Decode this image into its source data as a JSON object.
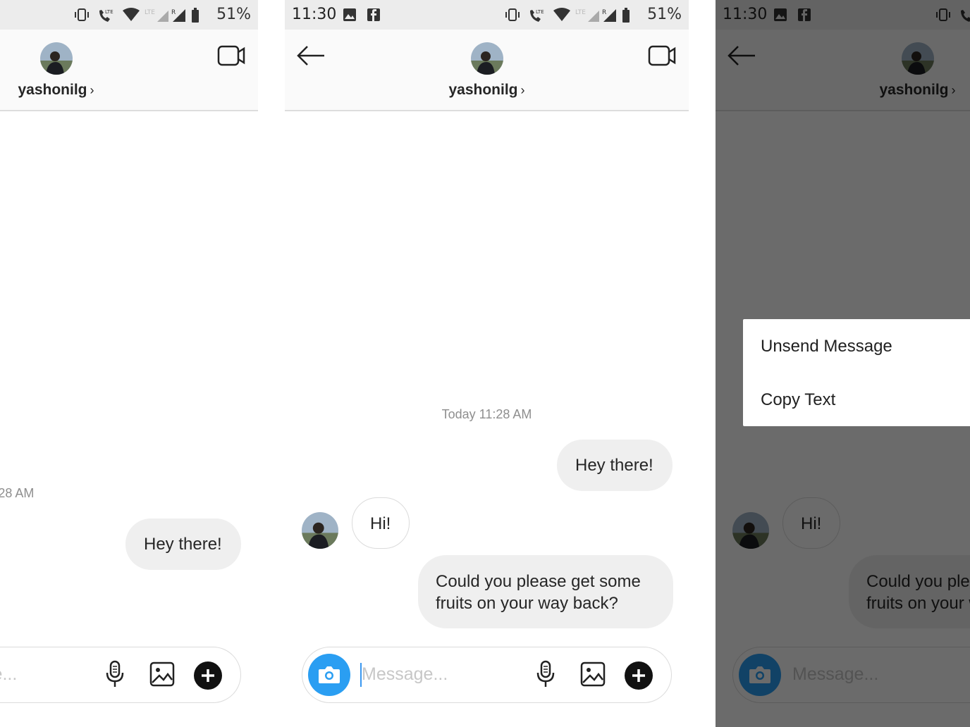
{
  "status": {
    "time": "11:30",
    "battery": "51%",
    "lte_label": "LTE",
    "roaming": "R"
  },
  "thread": {
    "username": "yashonilg",
    "chevron": "›",
    "timestamp": "Today 11:28 AM"
  },
  "messages": {
    "sent1": "Hey there!",
    "recv1": "Hi!",
    "sent2_line1": "Could you please get some",
    "sent2_line2": "fruits on your way back?"
  },
  "composer": {
    "placeholder": "Message..."
  },
  "menu": {
    "unsend": "Unsend Message",
    "copy": "Copy Text"
  },
  "colors": {
    "accent": "#2a9ef2",
    "bubble_sent": "#efefef",
    "overlay": "#6b6b6b"
  }
}
